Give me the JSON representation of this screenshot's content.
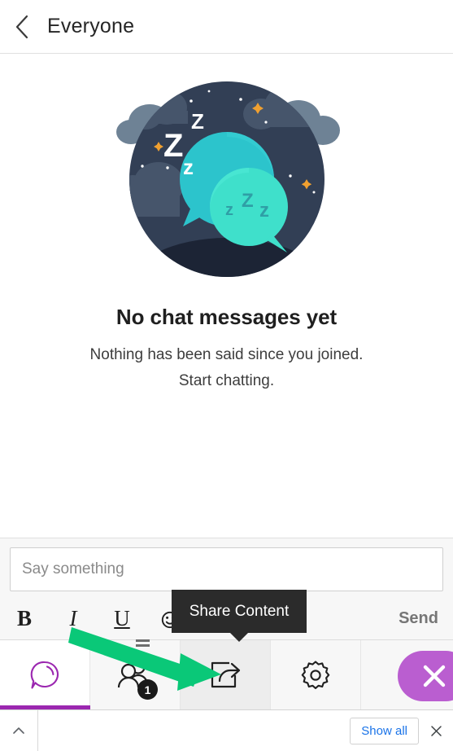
{
  "header": {
    "back_icon": "chevron-left-icon",
    "title": "Everyone"
  },
  "empty_state": {
    "illustration": "sleeping-chat-bubbles-night-illustration",
    "title": "No chat messages yet",
    "subtitle_line1": "Nothing has been said since you joined.",
    "subtitle_line2": "Start chatting."
  },
  "composer": {
    "placeholder": "Say something",
    "value": "",
    "format_buttons": [
      {
        "name": "bold-button",
        "label": "B"
      },
      {
        "name": "italic-button",
        "label": "I"
      },
      {
        "name": "underline-button",
        "label": "U"
      }
    ],
    "emoji_icon": "emoji-add-icon",
    "send_label": "Send"
  },
  "tooltip": {
    "text": "Share Content",
    "background": "#2b2b2b"
  },
  "bottom_nav": {
    "items": [
      {
        "name": "nav-chat",
        "icon": "chat-bubble-icon",
        "active": true
      },
      {
        "name": "nav-participants",
        "icon": "participants-icon",
        "badge": "1"
      },
      {
        "name": "nav-share-content",
        "icon": "share-export-icon",
        "highlighted": true
      },
      {
        "name": "nav-settings",
        "icon": "gear-icon"
      }
    ],
    "close_button": {
      "name": "close-meeting-button",
      "icon": "close-x-icon",
      "color": "#ba5ed0"
    },
    "active_color": "#9b27b0"
  },
  "download_bar": {
    "expand_icon": "chevron-up-icon",
    "show_all_label": "Show all",
    "close_icon": "close-icon",
    "link_color": "#1a73e8"
  },
  "annotation": {
    "arrow_color": "#0ac878",
    "arrow_from": "formatting-toolbar",
    "arrow_to": "share-content-nav-button"
  },
  "illustration_colors": {
    "circle_bg": "#323f55",
    "circle_dark": "#1c2435",
    "cloud_light": "#6e8295",
    "cloud_dark": "#46556b",
    "bubble_back": "#2cc4cc",
    "bubble_front": "#3fe0cb",
    "star_orange": "#f0a030",
    "z_white": "#ffffff"
  }
}
